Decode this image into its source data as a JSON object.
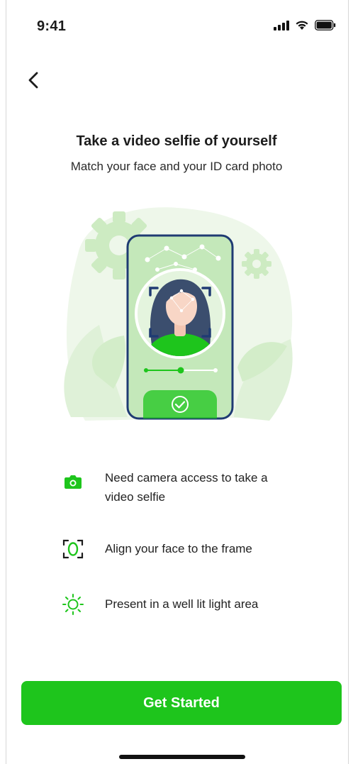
{
  "status_bar": {
    "time": "9:41",
    "icons": [
      "cellular-signal-icon",
      "wifi-icon",
      "battery-icon"
    ]
  },
  "header": {
    "back_icon": "chevron-left-icon"
  },
  "main": {
    "title": "Take a video selfie of yourself",
    "subtitle": "Match your face and your ID card photo"
  },
  "illustration": {
    "description_icon": "selfie-verification-illustration",
    "progress_steps": 3,
    "progress_current_step": 2
  },
  "tips": [
    {
      "icon": "camera-icon",
      "text": "Need camera access to take a video selfie"
    },
    {
      "icon": "face-frame-icon",
      "text": "Align your face to the frame"
    },
    {
      "icon": "sun-icon",
      "text": "Present in a well lit light area"
    }
  ],
  "cta": {
    "label": "Get Started"
  },
  "colors": {
    "accent": "#1ec51c",
    "accent_light": "#d4efcc",
    "phone_outline": "#1f3b73"
  }
}
